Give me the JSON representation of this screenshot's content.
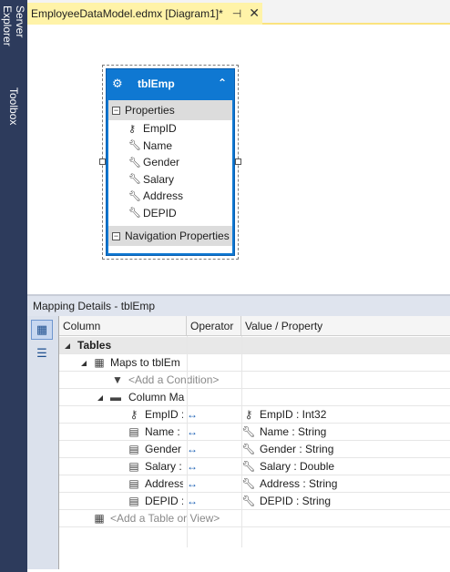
{
  "side_tabs": [
    "Server Explorer",
    "Toolbox"
  ],
  "doc_tab": {
    "title": "EmployeeDataModel.edmx [Diagram1]*",
    "pin_glyph": "⊣",
    "close_glyph": "✕"
  },
  "entity": {
    "name": "tblEmp",
    "properties_label": "Properties",
    "properties": [
      "EmpID",
      "Name",
      "Gender",
      "Salary",
      "Address",
      "DEPID"
    ],
    "navigation_label": "Navigation Properties"
  },
  "mapping": {
    "title": "Mapping Details - tblEmp",
    "columns": [
      "Column",
      "Operator",
      "Value / Property"
    ],
    "tables_label": "Tables",
    "maps_to": "Maps to tblEm",
    "add_condition": "<Add a Condition>",
    "column_mappings_label": "Column Ma",
    "rows": [
      {
        "column": "EmpID :",
        "arrow": "↔",
        "value": "EmpID : Int32"
      },
      {
        "column": "Name :",
        "arrow": "↔",
        "value": "Name : String"
      },
      {
        "column": "Gender",
        "arrow": "↔",
        "value": "Gender : String"
      },
      {
        "column": "Salary : '",
        "arrow": "↔",
        "value": "Salary : Double"
      },
      {
        "column": "Address",
        "arrow": "↔",
        "value": "Address : String"
      },
      {
        "column": "DEPID :",
        "arrow": "↔",
        "value": "DEPID : String"
      }
    ],
    "add_table": "<Add a Table or View>"
  },
  "colors": {
    "accent": "#0f78d2",
    "tab_active": "#fff3a8",
    "sidebar": "#2d3b5c"
  }
}
